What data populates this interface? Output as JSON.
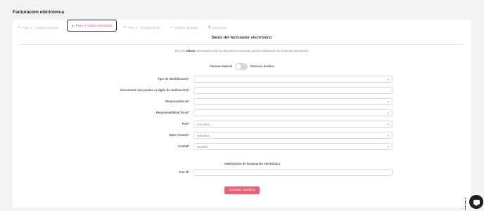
{
  "page": {
    "title": "Facturación electrónica"
  },
  "tabs": [
    {
      "icon": "list-icon",
      "glyph": "☰",
      "label": "Paso 1 - Campos previos"
    },
    {
      "icon": "user-icon",
      "glyph": "👤",
      "label": "Paso 2 - Datos facturador"
    },
    {
      "icon": "gear-icon",
      "glyph": "⚙",
      "label": "Paso 3 - Configuración"
    },
    {
      "icon": "card-icon",
      "glyph": "▭",
      "label": "Medios de pago"
    },
    {
      "icon": "document-icon",
      "glyph": "🗎",
      "label": "Impuestos"
    }
  ],
  "form": {
    "section_title": "Datos del facturador electrónico",
    "info_prefix": "En este ",
    "info_link": "enlace",
    "info_suffix": " encontrarás toda la información necesaria para la habilitación de la factura electrónica",
    "person_natural": "Persona Natural",
    "person_juridica": "Persona Jurídica",
    "fields": [
      {
        "label": "Tipo de identificación*",
        "value": ""
      },
      {
        "label": "Documento (sin puntos ni dígito de verificación)*",
        "value": ""
      },
      {
        "label": "Responsable de*",
        "value": ""
      },
      {
        "label": "Responsabilidad fiscal*",
        "value": ""
      },
      {
        "label": "País*",
        "value": "Colombia"
      },
      {
        "label": "Dpto / Estado*",
        "value": "Antioquia"
      },
      {
        "label": "Ciudad*",
        "value": "Medellín"
      }
    ],
    "habilitacion_title": "Habilitación de facturación electrónica",
    "test_id_label": "Test Id*",
    "test_id_value": "",
    "save_label": "Guardar cambios"
  }
}
